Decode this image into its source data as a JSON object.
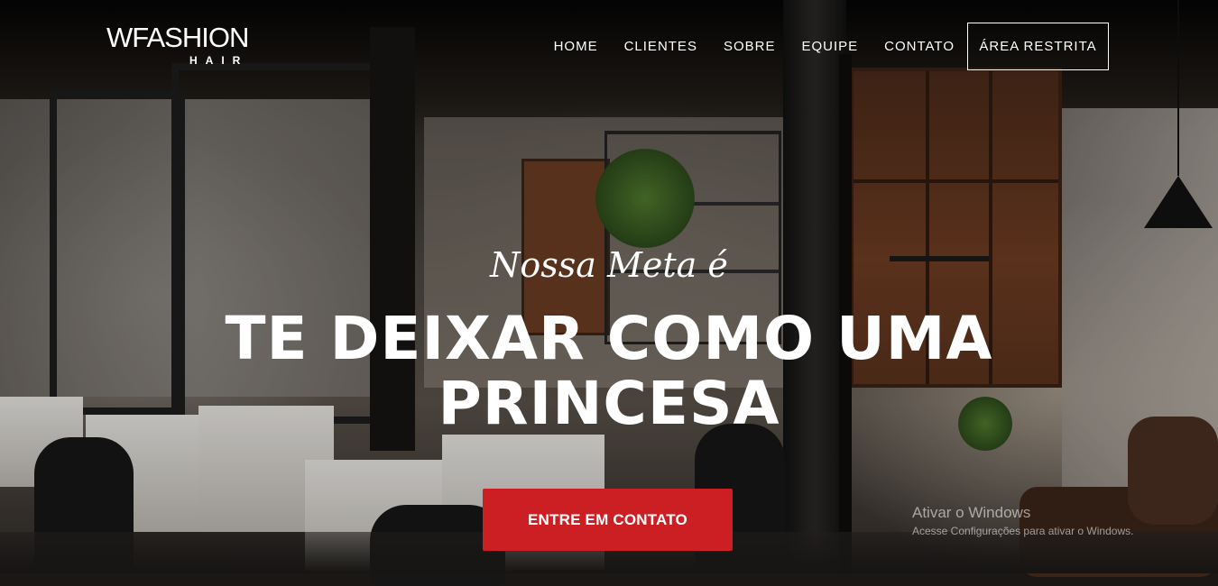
{
  "brand": {
    "logo_main": "WFASHION",
    "logo_sub": "HAIR"
  },
  "nav": {
    "items": [
      {
        "label": "HOME"
      },
      {
        "label": "CLIENTES"
      },
      {
        "label": "SOBRE"
      },
      {
        "label": "EQUIPE"
      },
      {
        "label": "CONTATO"
      }
    ],
    "cta_label": "ÁREA RESTRITA"
  },
  "hero": {
    "tagline": "Nossa Meta é",
    "headline_line1": "TE DEIXAR COMO UMA",
    "headline_line2": "PRINCESA",
    "cta_label": "ENTRE EM CONTATO"
  },
  "watermark": {
    "title": "Ativar o Windows",
    "subtitle": "Acesse Configurações para ativar o Windows."
  },
  "colors": {
    "cta_background": "#cc1f24",
    "text": "#ffffff"
  }
}
